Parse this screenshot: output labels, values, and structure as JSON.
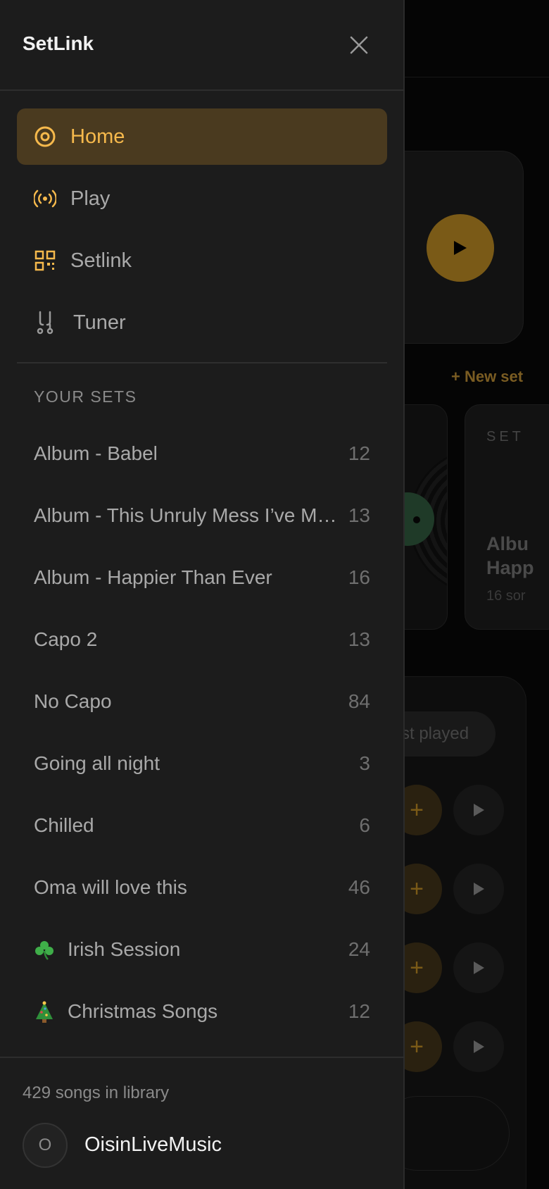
{
  "app": {
    "title": "SetLink"
  },
  "nav": {
    "items": [
      {
        "label": "Home",
        "icon": "target-icon",
        "active": true
      },
      {
        "label": "Play",
        "icon": "broadcast-icon",
        "active": false
      },
      {
        "label": "Setlink",
        "icon": "qr-code-icon",
        "active": false
      },
      {
        "label": "Tuner",
        "icon": "tuning-fork-icon",
        "active": false
      }
    ]
  },
  "sets": {
    "title": "YOUR SETS",
    "items": [
      {
        "name": "Album - Babel",
        "count": "12"
      },
      {
        "name": "Album - This Unruly Mess I’ve Made",
        "count": "13"
      },
      {
        "name": "Album - Happier Than Ever",
        "count": "16"
      },
      {
        "name": "Capo 2",
        "count": "13"
      },
      {
        "name": "No Capo",
        "count": "84"
      },
      {
        "name": "Going all night",
        "count": "3"
      },
      {
        "name": "Chilled",
        "count": "6"
      },
      {
        "name": "Oma will love this",
        "count": "46"
      },
      {
        "name": "Irish Session",
        "count": "24",
        "emoji": "shamrock-icon"
      },
      {
        "name": "Christmas Songs",
        "count": "12",
        "emoji": "christmas-tree-icon"
      }
    ]
  },
  "footer": {
    "library_count": "429 songs in library",
    "avatar_initial": "O",
    "username": "OisinLiveMusic"
  },
  "background": {
    "new_set": "+ New set",
    "card_label": "SET",
    "card_title_line1": "Albu",
    "card_title_line2": "Happ",
    "card_sub": "16 sor",
    "chip": "st played"
  },
  "colors": {
    "accent": "#f6b94c",
    "active_bg": "#4a3a1f",
    "drawer_bg": "#1c1c1c"
  }
}
